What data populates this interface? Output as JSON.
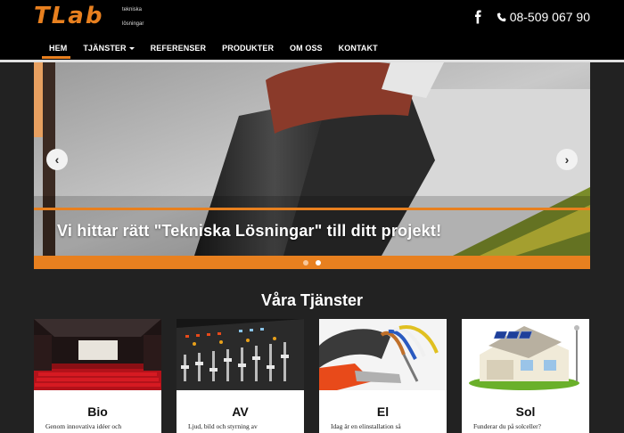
{
  "header": {
    "logo": {
      "main": "TLab",
      "sub_top": "tekniska",
      "sub_bottom": "lösningar"
    },
    "facebook_icon": "facebook-icon",
    "phone_icon": "phone-icon",
    "phone": "08-509 067 90"
  },
  "nav": {
    "items": [
      {
        "label": "HEM",
        "active": true
      },
      {
        "label": "TJÄNSTER",
        "dropdown": true
      },
      {
        "label": "REFERENSER"
      },
      {
        "label": "PRODUKTER"
      },
      {
        "label": "OM OSS"
      },
      {
        "label": "KONTAKT"
      }
    ]
  },
  "slider": {
    "caption": "Vi hittar rätt \"Tekniska Lösningar\" till ditt projekt!",
    "prev_icon": "chevron-left-icon",
    "next_icon": "chevron-right-icon",
    "slides": 2,
    "active_slide": 2
  },
  "services": {
    "title": "Våra Tjänster",
    "cards": [
      {
        "title": "Bio",
        "text": "Genom innovativa idéer och"
      },
      {
        "title": "AV",
        "text": "Ljud, bild och styrning av"
      },
      {
        "title": "El",
        "text": "Idag är en elinstallation så"
      },
      {
        "title": "Sol",
        "text": "Funderar du på solceller?"
      }
    ]
  },
  "colors": {
    "accent": "#e8801f",
    "background": "#222222",
    "header": "#000000"
  }
}
